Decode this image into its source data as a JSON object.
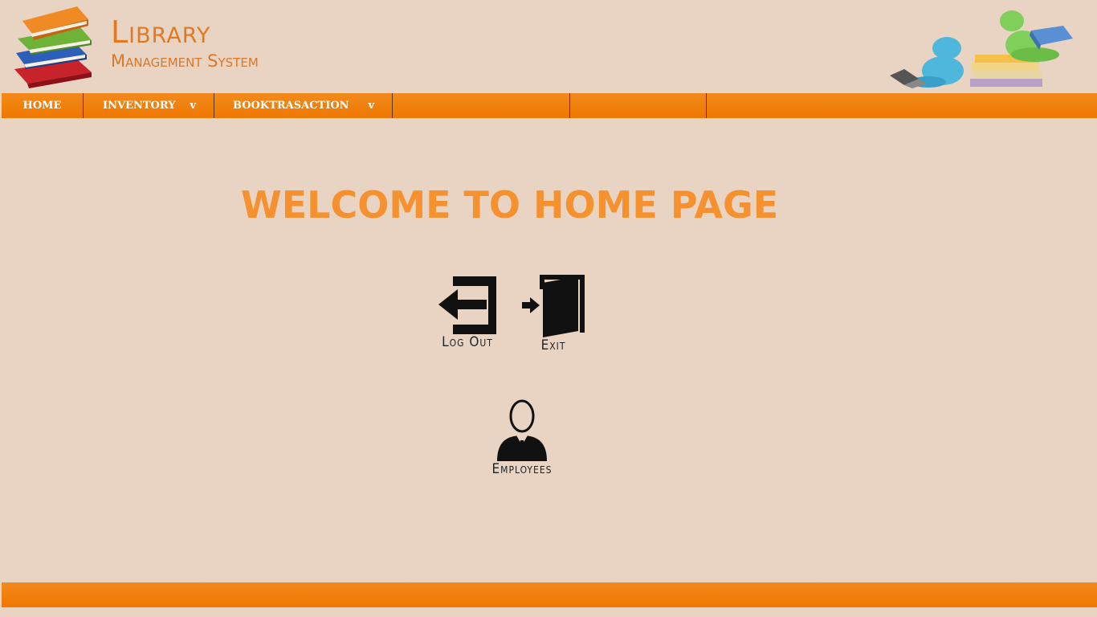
{
  "header": {
    "logo_line1": "Library",
    "logo_line2": "Management System"
  },
  "nav": {
    "items": [
      {
        "label": "HOME",
        "caret": ""
      },
      {
        "label": "INVENTORY",
        "caret": "v"
      },
      {
        "label": "BOOKTRASACTION",
        "caret": "v"
      },
      {
        "label": "",
        "caret": ""
      },
      {
        "label": "",
        "caret": ""
      },
      {
        "label": "",
        "caret": ""
      }
    ]
  },
  "main": {
    "welcome": "WELCOME TO HOME PAGE",
    "tiles": {
      "logout": "Log Out",
      "exit": "Exit",
      "employees": "Employees"
    }
  },
  "colors": {
    "accent": "#ef7800",
    "background": "#e9d4c4",
    "welcome_text": "#f5912e"
  }
}
